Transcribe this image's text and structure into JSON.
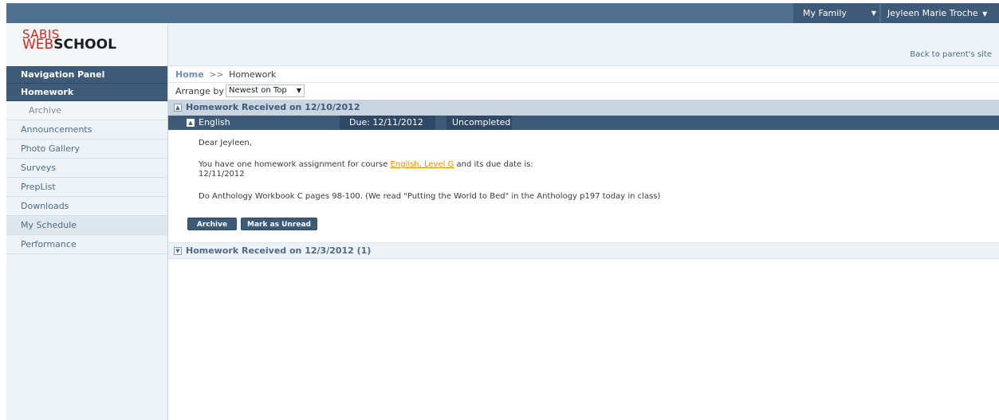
{
  "topbar": {
    "family_label": "My Family",
    "user_name": "Jeyleen Marie Troche"
  },
  "header": {
    "logo_line1": "SABIS",
    "logo_web": "WEB",
    "logo_school": "SCHOOL",
    "back_link": "Back to parent's site"
  },
  "sidebar": {
    "header": "Navigation Panel",
    "active_item": "Homework",
    "sub_item": "Archive",
    "items": [
      "Announcements",
      "Photo Gallery",
      "Surveys",
      "PrepList",
      "Downloads",
      "My Schedule",
      "Performance"
    ]
  },
  "breadcrumb": {
    "home": "Home",
    "separator": ">>",
    "current": "Homework"
  },
  "arrange": {
    "label": "Arrange by",
    "selected": "Newest on Top"
  },
  "group1": {
    "title": "Homework Received on 12/10/2012",
    "toggle": "▲"
  },
  "assignment": {
    "course": "English",
    "due": "Due: 12/11/2012",
    "status": "Uncompleted",
    "greeting": "Dear Jeyleen,",
    "intro_prefix": "You have one homework assignment for course",
    "course_link": "English, Level G",
    "intro_suffix": "and its due date is:",
    "due_date": "12/11/2012",
    "description": "Do Anthology Workbook C pages 98-100. (We read \"Putting the World to Bed\" in the Anthology p197 today in class)"
  },
  "buttons": {
    "archive": "Archive",
    "mark_unread": "Mark as Unread"
  },
  "group2": {
    "title": "Homework Received on 12/3/2012 (1)",
    "toggle": "▼"
  },
  "colors": {
    "topbar": "#50708f",
    "dark": "#3d5a78",
    "link_orange": "#f08a00"
  }
}
